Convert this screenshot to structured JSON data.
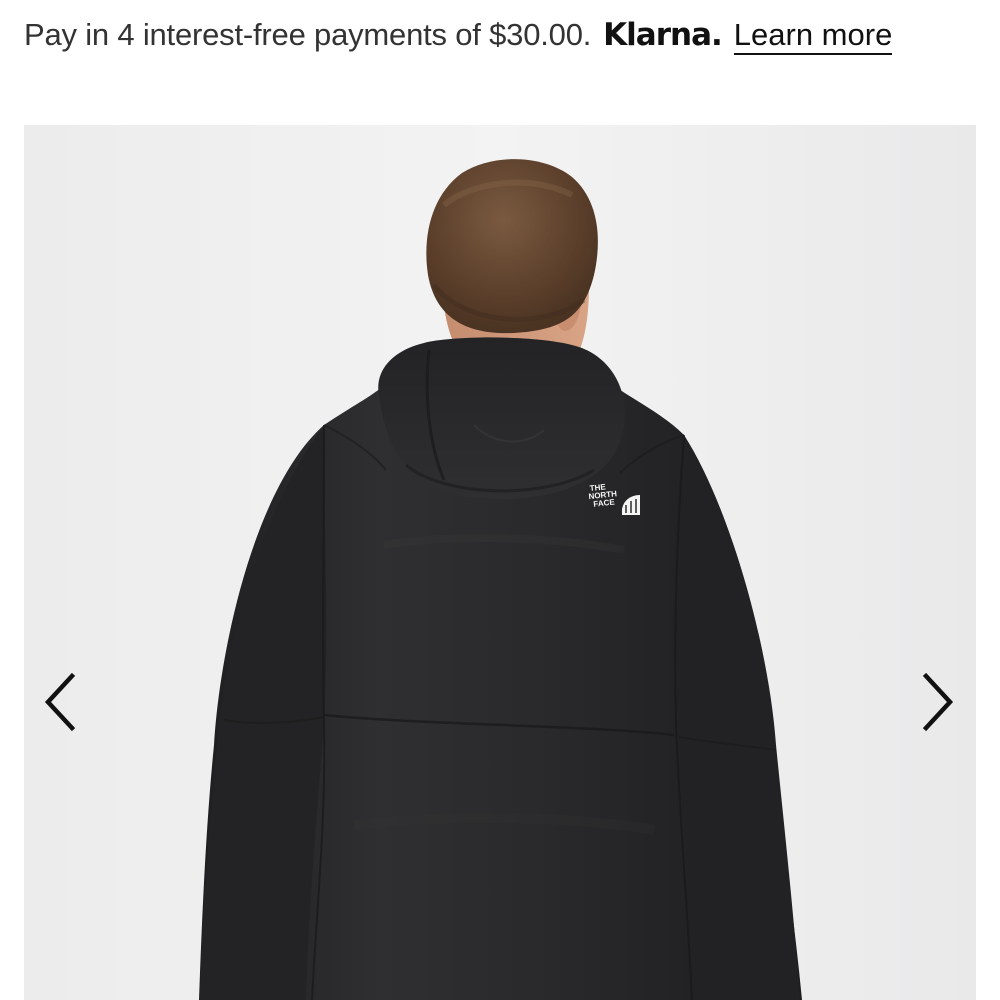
{
  "financing": {
    "message": "Pay in 4 interest-free payments of $30.00.",
    "provider_logo_text": "Klarna.",
    "learn_more_label": "Learn more"
  },
  "gallery": {
    "image_alt": "Back view of a man wearing a black hooded rain jacket",
    "brand_logo_text": "THE NORTH FACE",
    "prev_icon": "chevron-left-icon",
    "next_icon": "chevron-right-icon",
    "colors": {
      "background": "#efefef",
      "jacket": "#2b2b2d",
      "arrow": "#111111"
    }
  }
}
